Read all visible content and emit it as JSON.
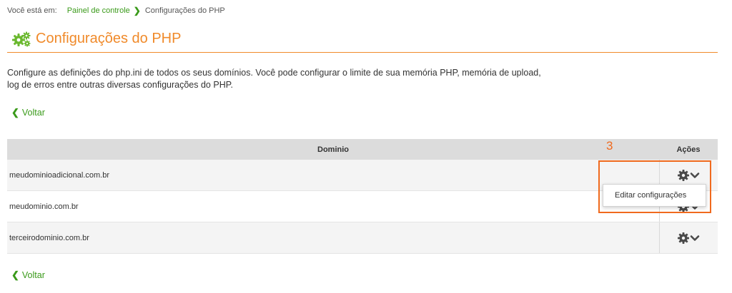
{
  "breadcrumb": {
    "prefix": "Você está em:",
    "home": "Painel de controle",
    "current": "Configurações do PHP"
  },
  "page": {
    "title": "Configurações do PHP",
    "description": "Configure as definições do php.ini de todos os seus domínios. Você pode configurar o limite de sua memória PHP, memória de upload, log de erros entre outras diversas configurações do PHP.",
    "back_label": "Voltar",
    "accent_color": "#f08a2a",
    "link_color": "#3a9a1a"
  },
  "table": {
    "headers": {
      "domain": "Dominio",
      "actions": "Ações"
    },
    "rows": [
      {
        "domain": "meudominioadicional.com.br"
      },
      {
        "domain": "meudominio.com.br"
      },
      {
        "domain": "terceirodominio.com.br"
      }
    ],
    "action_icons": [
      "gear-icon",
      "chevron-down-icon"
    ]
  },
  "dropdown": {
    "items": [
      "Editar configurações"
    ]
  },
  "annotation": {
    "step_number": "3",
    "color": "#f06a1e"
  }
}
